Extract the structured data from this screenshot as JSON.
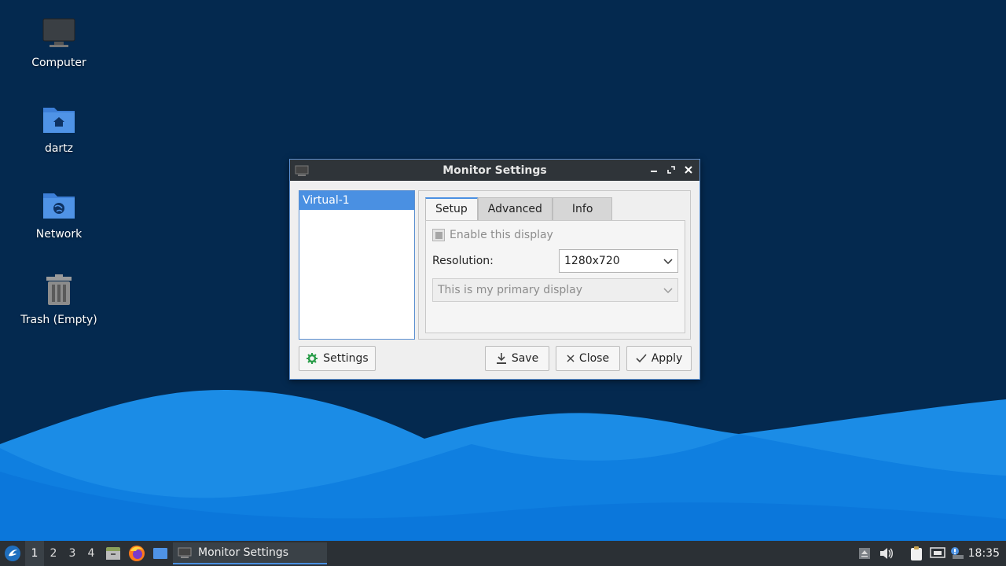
{
  "desktop": {
    "icons": [
      {
        "label": "Computer"
      },
      {
        "label": "dartz"
      },
      {
        "label": "Network"
      },
      {
        "label": "Trash (Empty)"
      }
    ]
  },
  "dialog": {
    "title": "Monitor Settings",
    "displays": [
      "Virtual-1"
    ],
    "tabs": [
      {
        "label": "Setup",
        "active": true
      },
      {
        "label": "Advanced",
        "active": false
      },
      {
        "label": "Info",
        "active": false
      }
    ],
    "setup": {
      "enable_label": "Enable this display",
      "enable_checked": true,
      "resolution_label": "Resolution:",
      "resolution_value": "1280x720",
      "primary_value": "This is my primary display"
    },
    "buttons": {
      "settings": "Settings",
      "save": "Save",
      "close": "Close",
      "apply": "Apply"
    }
  },
  "taskbar": {
    "workspaces": [
      "1",
      "2",
      "3",
      "4"
    ],
    "active_workspace": "1",
    "task_label": "Monitor Settings",
    "clock": "18:35"
  },
  "colors": {
    "desktop_bg": "#04294f",
    "accent": "#4a90e2",
    "panel": "#2b3035"
  }
}
